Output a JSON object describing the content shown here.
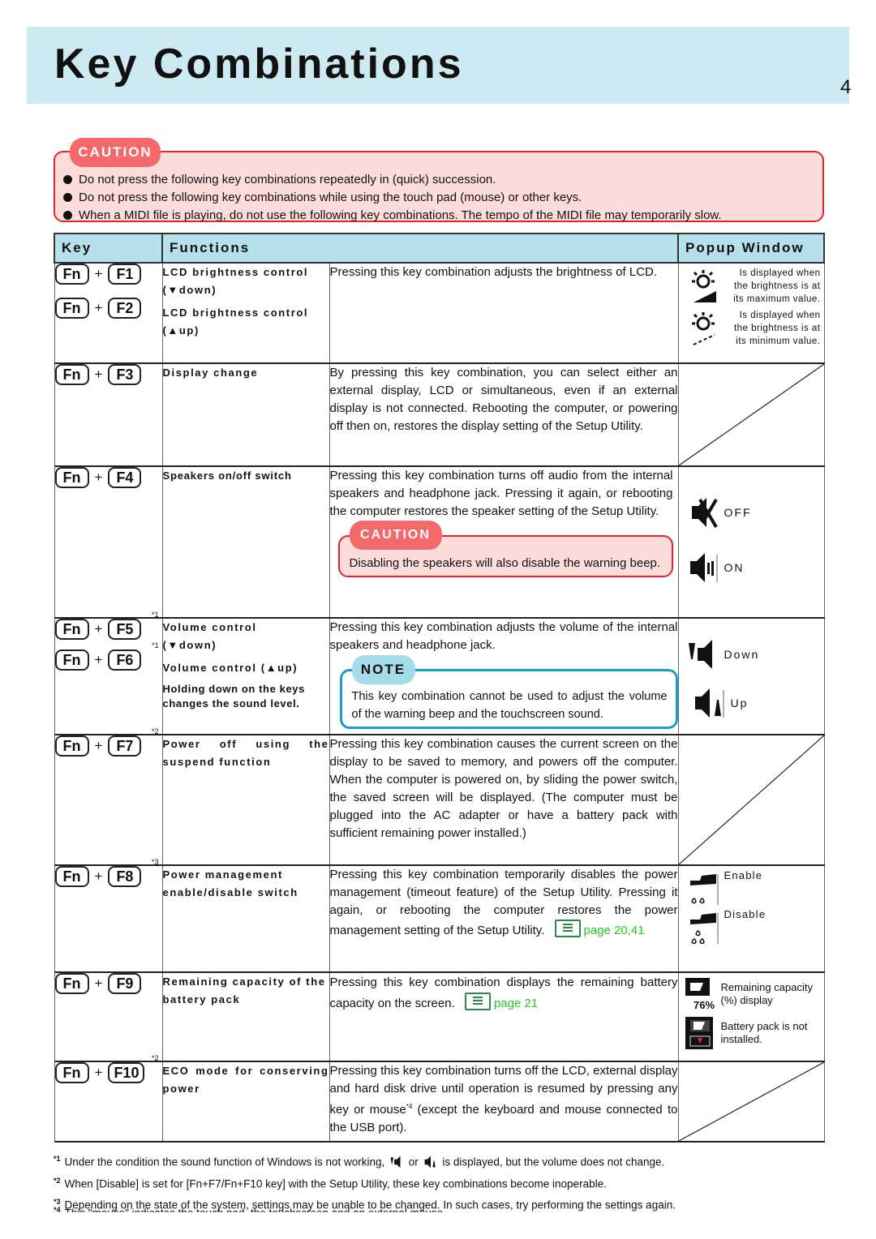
{
  "header": {
    "title": "Key Combinations",
    "page_number": "4"
  },
  "caution": {
    "label": "CAUTION",
    "items": [
      "Do not press the following key combinations repeatedly in (quick) succession.",
      "Do not press the following key combinations while using the touch pad (mouse) or other keys.",
      "When a MIDI file is playing, do not use the following key combinations.  The tempo of the MIDI file may temporarily slow."
    ]
  },
  "table": {
    "headers": {
      "key": "Key",
      "functions": "Functions",
      "popup": "Popup Window"
    },
    "plus": "+",
    "rows": [
      {
        "keys": [
          {
            "mod": "Fn",
            "key": "F1"
          },
          {
            "mod": "Fn",
            "key": "F2"
          }
        ],
        "functions": [
          "LCD brightness control (▼down)",
          "LCD brightness control (▲up)"
        ],
        "description": "Pressing this key combination adjusts the brightness of LCD.",
        "popup": [
          {
            "icon": "brightness-max-icon",
            "text": "Is displayed when the brightness is at its maximum value."
          },
          {
            "icon": "brightness-min-icon",
            "text": "Is displayed when the brightness is at its minimum value."
          }
        ]
      },
      {
        "keys": [
          {
            "mod": "Fn",
            "key": "F3"
          }
        ],
        "functions": [
          "Display change"
        ],
        "description": "By pressing this key combination, you can select either an external display, LCD or simultaneous, even if an external display is not connected.  Rebooting the computer, or powering off then on, restores the display setting of the Setup Utility."
      },
      {
        "keys": [
          {
            "mod": "Fn",
            "key": "F4"
          }
        ],
        "functions": [
          "Speakers on/off switch"
        ],
        "description": "Pressing this key combination turns off audio from the internal speakers and headphone jack.  Pressing it again, or rebooting the computer restores the speaker setting of the Setup Utility.",
        "caution": {
          "label": "CAUTION",
          "text": "Disabling the speakers will also disable the warning beep."
        },
        "popup": [
          {
            "icon": "speaker-off-icon",
            "text": "OFF"
          },
          {
            "icon": "speaker-on-icon",
            "text": "ON"
          }
        ]
      },
      {
        "keys": [
          {
            "mod": "Fn",
            "key": "F5",
            "note": "*1"
          },
          {
            "mod": "Fn",
            "key": "F6",
            "note": "*1"
          }
        ],
        "functions": [
          "Volume control (▼down)",
          "Volume control (▲up)"
        ],
        "function_note": "Holding down on the keys changes the sound level.",
        "description": "Pressing this key combination adjusts the volume of the internal speakers and headphone jack.",
        "note": {
          "label": "NOTE",
          "text": "This key combination cannot be used to adjust the volume of the warning beep and the touchscreen sound."
        },
        "popup": [
          {
            "icon": "volume-down-icon",
            "text": "Down"
          },
          {
            "icon": "volume-up-icon",
            "text": "Up"
          }
        ]
      },
      {
        "keys": [
          {
            "mod": "Fn",
            "key": "F7",
            "note": "*2"
          }
        ],
        "functions": [
          "Power off using the suspend function"
        ],
        "description": "Pressing this key combination causes the current screen on the display to be saved to memory, and powers off the computer.  When the computer is powered on, by sliding the power switch, the saved screen will be displayed.  (The computer must be plugged into the AC adapter or have a battery pack with sufficient remaining power installed.)"
      },
      {
        "keys": [
          {
            "mod": "Fn",
            "key": "F8",
            "note": "*3"
          }
        ],
        "functions": [
          "Power management enable/disable switch"
        ],
        "description": "Pressing this key combination temporarily disables the power management (timeout feature) of the Setup Utility.  Pressing it again, or rebooting the computer restores the power management setting of the Setup Utility.",
        "xref": "page 20,41",
        "popup": [
          {
            "icon": "power-mgmt-enable-icon",
            "text": "Enable"
          },
          {
            "icon": "power-mgmt-disable-icon",
            "text": "Disable"
          }
        ]
      },
      {
        "keys": [
          {
            "mod": "Fn",
            "key": "F9"
          }
        ],
        "functions": [
          "Remaining capacity of the battery pack"
        ],
        "description": "Pressing this key combination displays the remaining battery capacity on the screen.",
        "xref": "page 21",
        "popup": [
          {
            "icon": "battery-capacity-icon",
            "text": "Remaining capacity (%) display",
            "icon_value": "76%"
          },
          {
            "icon": "battery-not-installed-icon",
            "text": "Battery pack is not installed."
          }
        ]
      },
      {
        "keys": [
          {
            "mod": "Fn",
            "key": "F10",
            "note": "*2"
          }
        ],
        "functions": [
          "ECO mode for conserving power"
        ],
        "description_parts": [
          "Pressing this key combination turns off the LCD, external display and hard disk drive until operation is resumed by pressing any key or mouse",
          "*4",
          " (except  the keyboard and mouse connected to the USB port)."
        ]
      }
    ]
  },
  "footnotes": [
    {
      "mark": "*1",
      "text_before": "Under the condition the sound function of Windows is not working,",
      "text_mid": "or",
      "text_after": "is displayed, but the volume does not change."
    },
    {
      "mark": "*2",
      "text": "When [Disable] is set for [Fn+F7/Fn+F10 key] with the Setup Utility, these key combinations become inoperable."
    },
    {
      "mark": "*3",
      "text": "Depending on the state of the system, settings may be unable to be changed.  In such cases, try performing the settings again."
    },
    {
      "mark": "*4",
      "text": "This \"mouse\" indicates the touch pad, the touchscreen and an external mouse."
    }
  ],
  "colors": {
    "banner": "#cdeaf3",
    "table_header": "#b6e0eb",
    "caution_fill": "#fddcdc",
    "caution_border": "#e8222a",
    "caution_tag": "#f4696a",
    "note_border": "#1aa0c8",
    "xref": "#22cc22"
  }
}
